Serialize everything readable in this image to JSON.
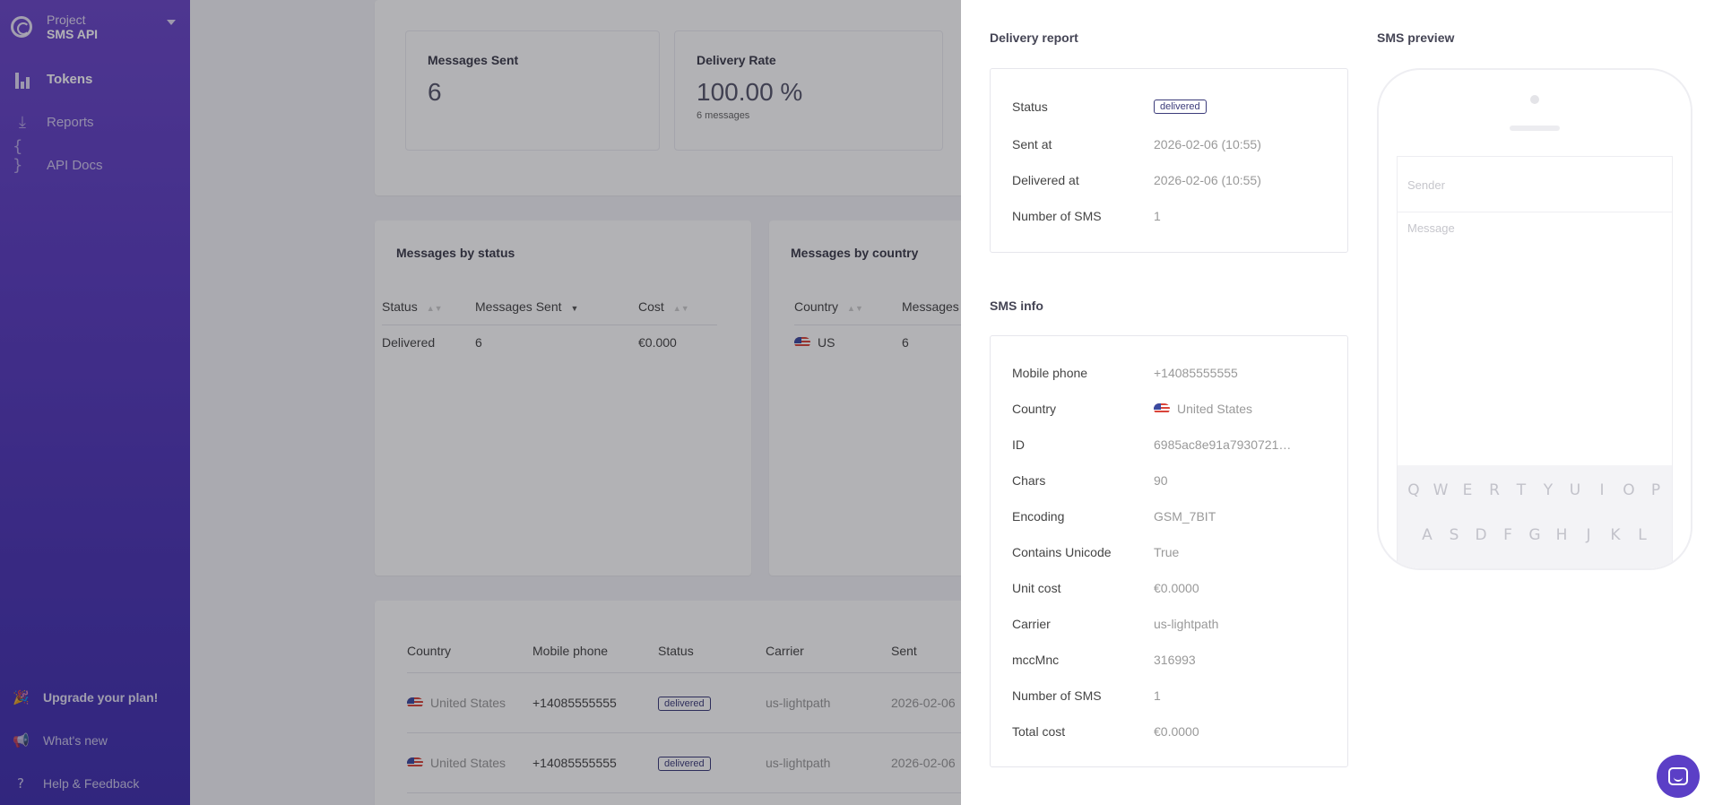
{
  "sidebar": {
    "project_label": "Project",
    "project_name": "SMS API",
    "items": [
      {
        "label": "Tokens"
      },
      {
        "label": "Reports"
      },
      {
        "label": "API Docs"
      }
    ],
    "bottom": {
      "upgrade": "Upgrade your plan!",
      "whats_new": "What's new",
      "help": "Help & Feedback"
    }
  },
  "stats": {
    "messages_sent": {
      "title": "Messages Sent",
      "value": "6"
    },
    "delivery_rate": {
      "title": "Delivery Rate",
      "value": "100.00 %",
      "sub": "6 messages"
    }
  },
  "by_status": {
    "title": "Messages by status",
    "headers": [
      "Status",
      "Messages Sent",
      "Cost"
    ],
    "rows": [
      [
        "Delivered",
        "6",
        "€0.000"
      ]
    ]
  },
  "by_country": {
    "title": "Messages by country",
    "headers": [
      "Country",
      "Messages"
    ],
    "rows": [
      [
        "US",
        "6"
      ]
    ]
  },
  "messages_table": {
    "headers": [
      "Country",
      "Mobile phone",
      "Status",
      "Carrier",
      "Sent"
    ],
    "rows": [
      {
        "country": "United States",
        "phone": "+14085555555",
        "status": "delivered",
        "carrier": "us-lightpath",
        "sent": "2026-02-06"
      },
      {
        "country": "United States",
        "phone": "+14085555555",
        "status": "delivered",
        "carrier": "us-lightpath",
        "sent": "2026-02-06"
      }
    ]
  },
  "drawer": {
    "delivery_report_title": "Delivery report",
    "delivery_report": {
      "status_key": "Status",
      "status_value": "delivered",
      "sent_at_key": "Sent at",
      "sent_at_value": "2026-02-06 (10:55)",
      "delivered_at_key": "Delivered at",
      "delivered_at_value": "2026-02-06 (10:55)",
      "num_sms_key": "Number of SMS",
      "num_sms_value": "1"
    },
    "sms_info_title": "SMS info",
    "sms_info": [
      {
        "key": "Mobile phone",
        "value": "+14085555555"
      },
      {
        "key": "Country",
        "value": "United States"
      },
      {
        "key": "ID",
        "value": "6985ac8e91a7930721…"
      },
      {
        "key": "Chars",
        "value": "90"
      },
      {
        "key": "Encoding",
        "value": "GSM_7BIT"
      },
      {
        "key": "Contains Unicode",
        "value": "True"
      },
      {
        "key": "Unit cost",
        "value": "€0.0000"
      },
      {
        "key": "Carrier",
        "value": "us-lightpath"
      },
      {
        "key": "mccMnc",
        "value": "316993"
      },
      {
        "key": "Number of SMS",
        "value": "1"
      },
      {
        "key": "Total cost",
        "value": "€0.0000"
      }
    ],
    "sms_preview_title": "SMS preview",
    "preview": {
      "sender_placeholder": "Sender",
      "message_placeholder": "Message",
      "kbd_row1": [
        "Q",
        "W",
        "E",
        "R",
        "T",
        "Y",
        "U",
        "I",
        "O",
        "P"
      ],
      "kbd_row2": [
        "A",
        "S",
        "D",
        "F",
        "G",
        "H",
        "J",
        "K",
        "L"
      ]
    }
  },
  "colors": {
    "accent": "#5b3fc6",
    "sidebar_top": "#6a46c8",
    "sidebar_bottom": "#3f2fae"
  }
}
